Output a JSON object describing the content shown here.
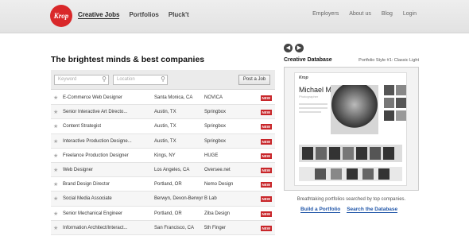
{
  "brand": {
    "logo_text": "Krop"
  },
  "main_nav": [
    "Creative Jobs",
    "Portfolios",
    "Pluck't"
  ],
  "top_nav": [
    "Employers",
    "About us",
    "Blog",
    "Login"
  ],
  "headline": "The brightest minds & best companies",
  "search": {
    "keyword_placeholder": "Keyword",
    "location_placeholder": "Location",
    "post_job_label": "Post a Job"
  },
  "jobs": [
    {
      "title": "E-Commerce Web Designer",
      "location": "Santa Monica, CA",
      "company": "NOVICA",
      "badge": "NEW"
    },
    {
      "title": "Senior Interactive Art Directo...",
      "location": "Austin, TX",
      "company": "Springbox",
      "badge": "NEW"
    },
    {
      "title": "Content Strategist",
      "location": "Austin, TX",
      "company": "Springbox",
      "badge": "NEW"
    },
    {
      "title": "Interactive Production Designe...",
      "location": "Austin, TX",
      "company": "Springbox",
      "badge": "NEW"
    },
    {
      "title": "Freelance Production Designer",
      "location": "Kings, NY",
      "company": "HUGE",
      "badge": "NEW"
    },
    {
      "title": "Web Designer",
      "location": "Los Angeles, CA",
      "company": "Oversee.net",
      "badge": "NEW"
    },
    {
      "title": "Brand Design Director",
      "location": "Portland, OR",
      "company": "Nemo Design",
      "badge": "NEW"
    },
    {
      "title": "Social Media Associate",
      "location": "Berwyn, Devon-Berwyr",
      "company": "B Lab",
      "badge": "NEW"
    },
    {
      "title": "Senior Mechanical Engineer",
      "location": "Portland, OR",
      "company": "Ziba Design",
      "badge": "NEW"
    },
    {
      "title": "Information Architect/Interact...",
      "location": "San Francisco, CA",
      "company": "5th Finger",
      "badge": "NEW"
    }
  ],
  "showcase": {
    "heading": "Creative Database",
    "style_label": "Portfolio Style #1: Classic Light",
    "preview_logo": "Krop",
    "preview_name": "Michael Muller",
    "preview_subtitle": "Photographer",
    "caption": "Breathtaking portfolios searched by top companies.",
    "build_link": "Build a Portfolio",
    "search_link": "Search the Database"
  },
  "colors": {
    "accent": "#d9282a",
    "link": "#1f55a8",
    "badge": "#c8262a"
  }
}
